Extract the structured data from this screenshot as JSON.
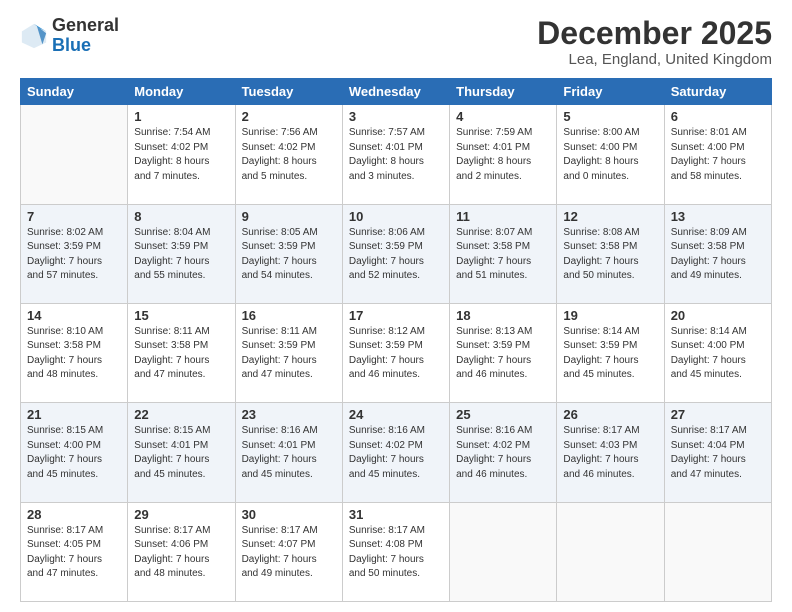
{
  "logo": {
    "general": "General",
    "blue": "Blue"
  },
  "title": "December 2025",
  "location": "Lea, England, United Kingdom",
  "days_header": [
    "Sunday",
    "Monday",
    "Tuesday",
    "Wednesday",
    "Thursday",
    "Friday",
    "Saturday"
  ],
  "weeks": [
    [
      {
        "day": "",
        "info": ""
      },
      {
        "day": "1",
        "info": "Sunrise: 7:54 AM\nSunset: 4:02 PM\nDaylight: 8 hours\nand 7 minutes."
      },
      {
        "day": "2",
        "info": "Sunrise: 7:56 AM\nSunset: 4:02 PM\nDaylight: 8 hours\nand 5 minutes."
      },
      {
        "day": "3",
        "info": "Sunrise: 7:57 AM\nSunset: 4:01 PM\nDaylight: 8 hours\nand 3 minutes."
      },
      {
        "day": "4",
        "info": "Sunrise: 7:59 AM\nSunset: 4:01 PM\nDaylight: 8 hours\nand 2 minutes."
      },
      {
        "day": "5",
        "info": "Sunrise: 8:00 AM\nSunset: 4:00 PM\nDaylight: 8 hours\nand 0 minutes."
      },
      {
        "day": "6",
        "info": "Sunrise: 8:01 AM\nSunset: 4:00 PM\nDaylight: 7 hours\nand 58 minutes."
      }
    ],
    [
      {
        "day": "7",
        "info": "Sunrise: 8:02 AM\nSunset: 3:59 PM\nDaylight: 7 hours\nand 57 minutes."
      },
      {
        "day": "8",
        "info": "Sunrise: 8:04 AM\nSunset: 3:59 PM\nDaylight: 7 hours\nand 55 minutes."
      },
      {
        "day": "9",
        "info": "Sunrise: 8:05 AM\nSunset: 3:59 PM\nDaylight: 7 hours\nand 54 minutes."
      },
      {
        "day": "10",
        "info": "Sunrise: 8:06 AM\nSunset: 3:59 PM\nDaylight: 7 hours\nand 52 minutes."
      },
      {
        "day": "11",
        "info": "Sunrise: 8:07 AM\nSunset: 3:58 PM\nDaylight: 7 hours\nand 51 minutes."
      },
      {
        "day": "12",
        "info": "Sunrise: 8:08 AM\nSunset: 3:58 PM\nDaylight: 7 hours\nand 50 minutes."
      },
      {
        "day": "13",
        "info": "Sunrise: 8:09 AM\nSunset: 3:58 PM\nDaylight: 7 hours\nand 49 minutes."
      }
    ],
    [
      {
        "day": "14",
        "info": "Sunrise: 8:10 AM\nSunset: 3:58 PM\nDaylight: 7 hours\nand 48 minutes."
      },
      {
        "day": "15",
        "info": "Sunrise: 8:11 AM\nSunset: 3:58 PM\nDaylight: 7 hours\nand 47 minutes."
      },
      {
        "day": "16",
        "info": "Sunrise: 8:11 AM\nSunset: 3:59 PM\nDaylight: 7 hours\nand 47 minutes."
      },
      {
        "day": "17",
        "info": "Sunrise: 8:12 AM\nSunset: 3:59 PM\nDaylight: 7 hours\nand 46 minutes."
      },
      {
        "day": "18",
        "info": "Sunrise: 8:13 AM\nSunset: 3:59 PM\nDaylight: 7 hours\nand 46 minutes."
      },
      {
        "day": "19",
        "info": "Sunrise: 8:14 AM\nSunset: 3:59 PM\nDaylight: 7 hours\nand 45 minutes."
      },
      {
        "day": "20",
        "info": "Sunrise: 8:14 AM\nSunset: 4:00 PM\nDaylight: 7 hours\nand 45 minutes."
      }
    ],
    [
      {
        "day": "21",
        "info": "Sunrise: 8:15 AM\nSunset: 4:00 PM\nDaylight: 7 hours\nand 45 minutes."
      },
      {
        "day": "22",
        "info": "Sunrise: 8:15 AM\nSunset: 4:01 PM\nDaylight: 7 hours\nand 45 minutes."
      },
      {
        "day": "23",
        "info": "Sunrise: 8:16 AM\nSunset: 4:01 PM\nDaylight: 7 hours\nand 45 minutes."
      },
      {
        "day": "24",
        "info": "Sunrise: 8:16 AM\nSunset: 4:02 PM\nDaylight: 7 hours\nand 45 minutes."
      },
      {
        "day": "25",
        "info": "Sunrise: 8:16 AM\nSunset: 4:02 PM\nDaylight: 7 hours\nand 46 minutes."
      },
      {
        "day": "26",
        "info": "Sunrise: 8:17 AM\nSunset: 4:03 PM\nDaylight: 7 hours\nand 46 minutes."
      },
      {
        "day": "27",
        "info": "Sunrise: 8:17 AM\nSunset: 4:04 PM\nDaylight: 7 hours\nand 47 minutes."
      }
    ],
    [
      {
        "day": "28",
        "info": "Sunrise: 8:17 AM\nSunset: 4:05 PM\nDaylight: 7 hours\nand 47 minutes."
      },
      {
        "day": "29",
        "info": "Sunrise: 8:17 AM\nSunset: 4:06 PM\nDaylight: 7 hours\nand 48 minutes."
      },
      {
        "day": "30",
        "info": "Sunrise: 8:17 AM\nSunset: 4:07 PM\nDaylight: 7 hours\nand 49 minutes."
      },
      {
        "day": "31",
        "info": "Sunrise: 8:17 AM\nSunset: 4:08 PM\nDaylight: 7 hours\nand 50 minutes."
      },
      {
        "day": "",
        "info": ""
      },
      {
        "day": "",
        "info": ""
      },
      {
        "day": "",
        "info": ""
      }
    ]
  ]
}
